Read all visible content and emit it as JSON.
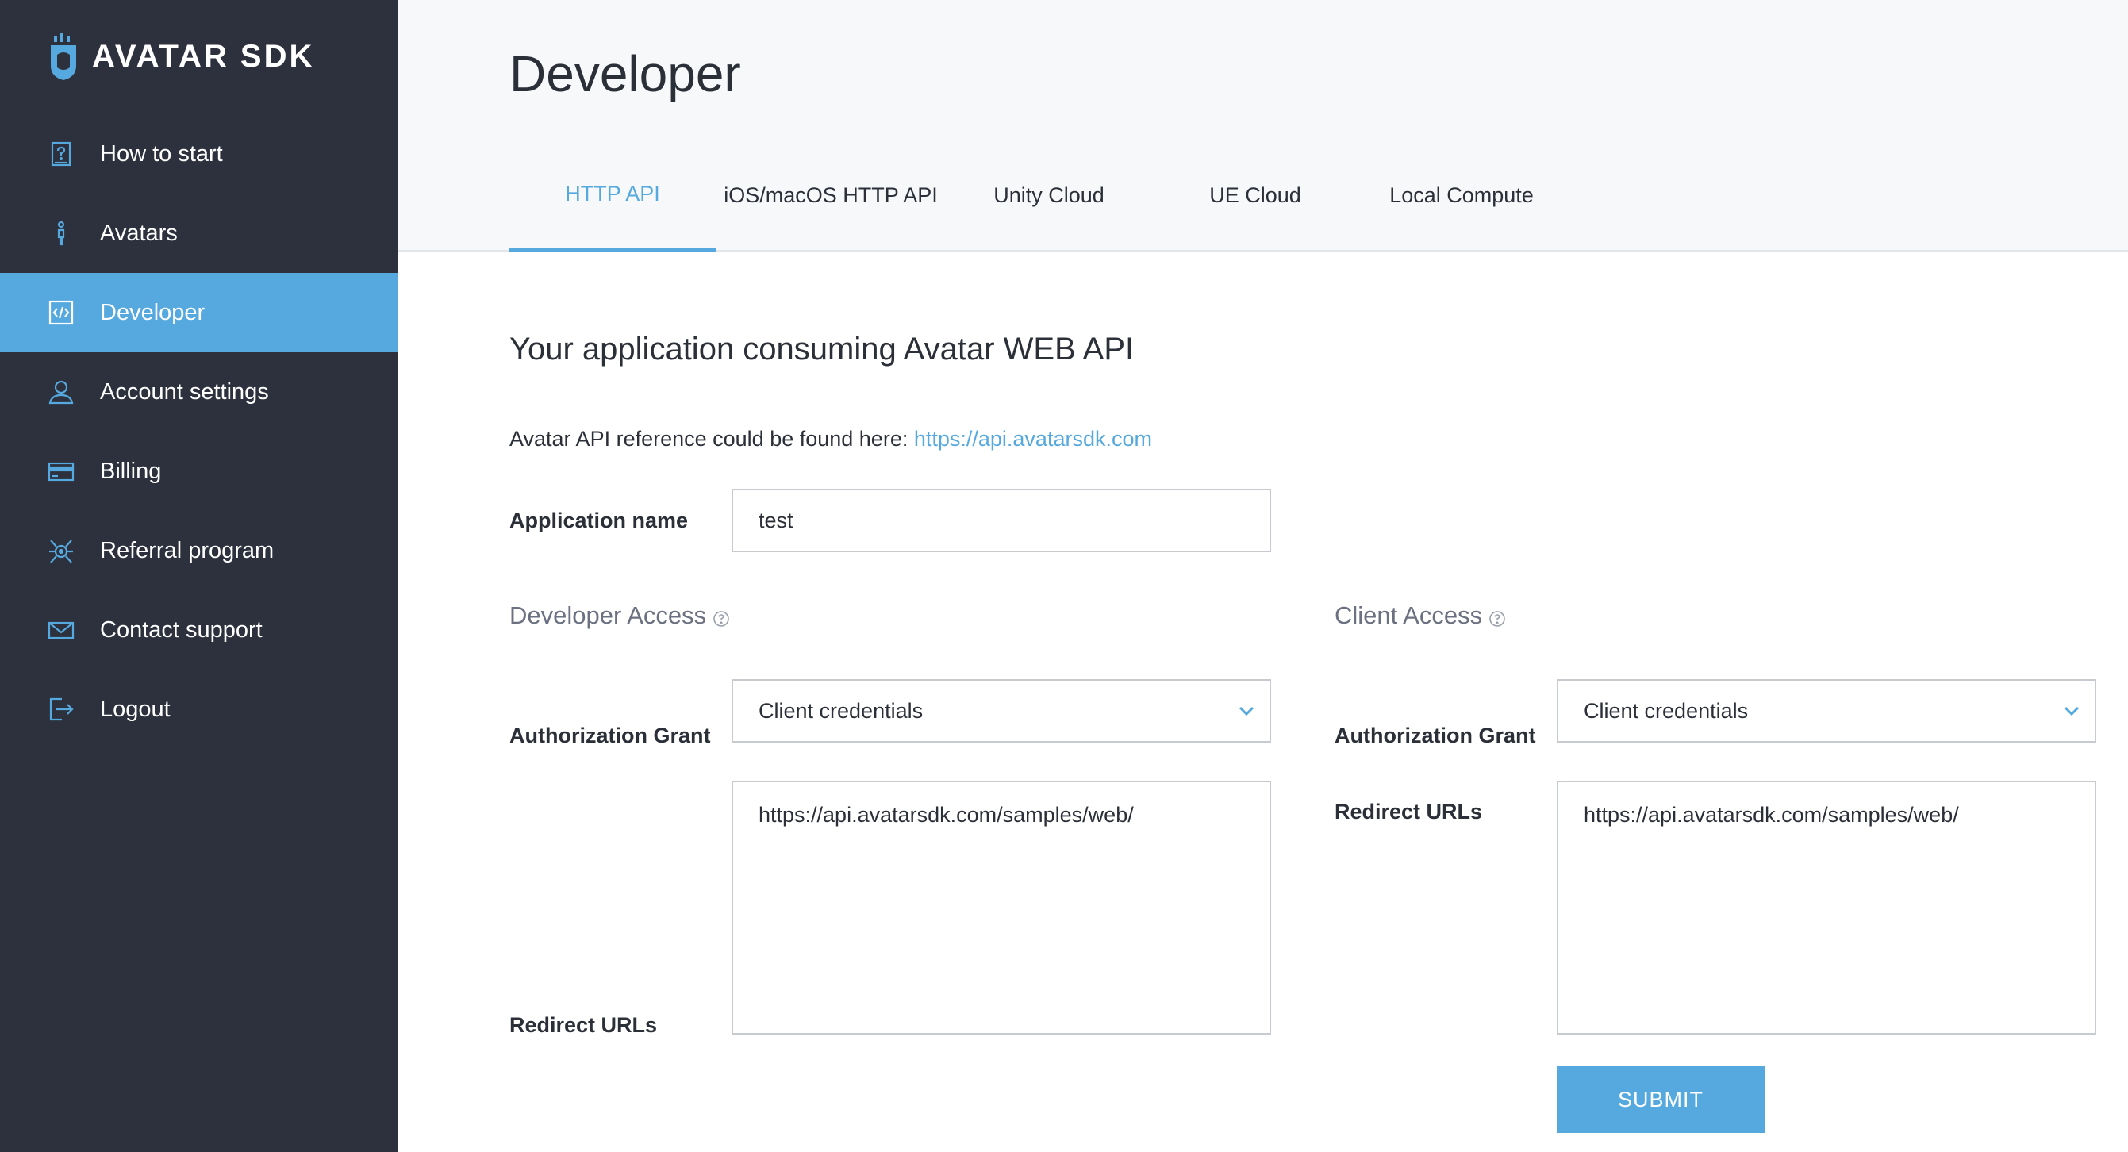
{
  "brand": {
    "name": "AVATAR SDK",
    "accent": "#56a9de",
    "sidebar_bg": "#2c313d"
  },
  "sidebar": {
    "items": [
      {
        "label": "How to start",
        "icon": "help-book-icon"
      },
      {
        "label": "Avatars",
        "icon": "person-icon"
      },
      {
        "label": "Developer",
        "icon": "code-icon",
        "active": true
      },
      {
        "label": "Account settings",
        "icon": "user-icon"
      },
      {
        "label": "Billing",
        "icon": "credit-card-icon"
      },
      {
        "label": "Referral program",
        "icon": "referral-icon"
      },
      {
        "label": "Contact support",
        "icon": "mail-icon"
      },
      {
        "label": "Logout",
        "icon": "logout-icon"
      }
    ]
  },
  "header": {
    "title": "Developer",
    "tabs": [
      {
        "label": "HTTP API",
        "active": true
      },
      {
        "label": "iOS/macOS HTTP API"
      },
      {
        "label": "Unity Cloud"
      },
      {
        "label": "UE Cloud"
      },
      {
        "label": "Local Compute"
      }
    ]
  },
  "content": {
    "section_title": "Your application consuming Avatar WEB API",
    "reference_text": "Avatar API reference could be found here: ",
    "reference_link": "https://api.avatarsdk.com",
    "app_name_label": "Application name",
    "app_name_value": "test",
    "developer_access": {
      "heading": "Developer Access",
      "grant_label": "Authorization Grant",
      "grant_value": "Client credentials",
      "redirect_label": "Redirect URLs",
      "redirect_value": "https://api.avatarsdk.com/samples/web/"
    },
    "client_access": {
      "heading": "Client Access",
      "grant_label": "Authorization Grant",
      "grant_value": "Client credentials",
      "redirect_label": "Redirect URLs",
      "redirect_value": "https://api.avatarsdk.com/samples/web/"
    },
    "submit_label": "SUBMIT"
  }
}
